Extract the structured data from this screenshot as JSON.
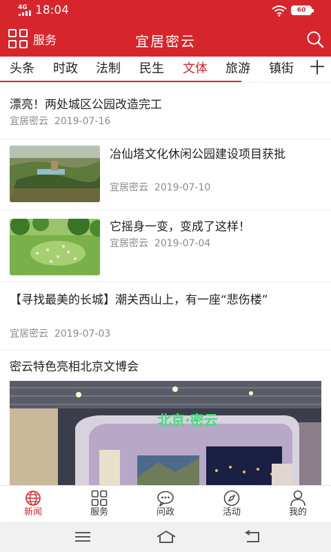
{
  "status_bar": {
    "network": "4G",
    "time": "18:04",
    "battery": "60"
  },
  "header": {
    "service_label": "服务",
    "title": "宜居密云"
  },
  "tabs": [
    {
      "label": "头条",
      "active": false
    },
    {
      "label": "时政",
      "active": false
    },
    {
      "label": "法制",
      "active": false
    },
    {
      "label": "民生",
      "active": false
    },
    {
      "label": "文体",
      "active": true
    },
    {
      "label": "旅游",
      "active": false
    },
    {
      "label": "镇街",
      "active": false
    }
  ],
  "tab_more": "十",
  "news": [
    {
      "title": "漂亮！两处城区公园改造完工",
      "source": "宜居密云",
      "date": "2019-07-16"
    },
    {
      "title": "冶仙塔文化休闲公园建设项目获批",
      "source": "宜居密云",
      "date": "2019-07-10"
    },
    {
      "title": "它摇身一变，变成了这样！",
      "source": "宜居密云",
      "date": "2019-07-04"
    },
    {
      "title": "【寻找最美的长城】潮关西山上，有一座“悲伤楼”",
      "source": "宜居密云",
      "date": "2019-07-03"
    },
    {
      "title": "密云特色亮相北京文博会",
      "banner_text": "北京·密云"
    }
  ],
  "bottom_nav": [
    {
      "label": "新闻",
      "icon": "globe-icon",
      "active": true
    },
    {
      "label": "服务",
      "icon": "grid-icon",
      "active": false
    },
    {
      "label": "问政",
      "icon": "chat-icon",
      "active": false
    },
    {
      "label": "活动",
      "icon": "compass-icon",
      "active": false
    },
    {
      "label": "我的",
      "icon": "person-icon",
      "active": false
    }
  ],
  "colors": {
    "brand": "#d6262b",
    "meta": "#8a8a8a"
  }
}
